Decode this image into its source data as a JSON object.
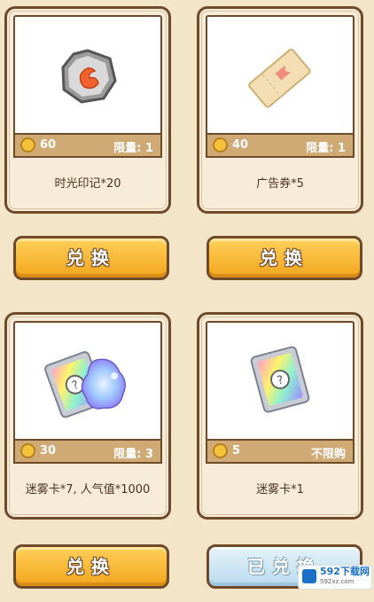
{
  "items": [
    {
      "name": "时光印记*20",
      "cost": "60",
      "limit": "限量: 1",
      "button": "兑换",
      "state": "available"
    },
    {
      "name": "广告券*5",
      "cost": "40",
      "limit": "限量: 1",
      "button": "兑换",
      "state": "available"
    },
    {
      "name": "迷雾卡*7, 人气值*1000",
      "cost": "30",
      "limit": "限量: 3",
      "button": "兑换",
      "state": "available"
    },
    {
      "name": "迷雾卡*1",
      "cost": "5",
      "limit": "不限购",
      "button": "已兑换",
      "state": "redeemed"
    }
  ],
  "watermark": {
    "brand": "592下载网",
    "url": "592xz.com"
  },
  "colors": {
    "panel": "#f7ecd7",
    "border": "#6e4a2b",
    "price_bar": "#d0aa74",
    "button": "#f7b42c",
    "button_done": "#cde8f5"
  },
  "icons": [
    "time-stamp-token-icon",
    "ad-ticket-icon",
    "fog-card-bundle-icon",
    "fog-card-icon"
  ]
}
